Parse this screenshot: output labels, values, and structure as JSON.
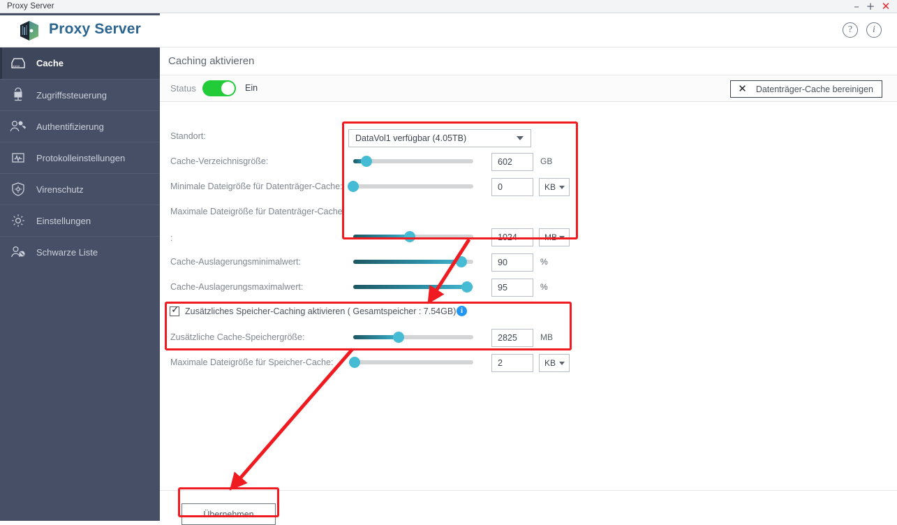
{
  "window": {
    "title": "Proxy Server",
    "minimize": "–",
    "maximize": "+",
    "close": "✕"
  },
  "header": {
    "app_title": "Proxy Server",
    "help_glyph": "?",
    "info_glyph": "i"
  },
  "sidebar": {
    "items": [
      {
        "label": "Cache",
        "icon": "drive-icon",
        "active": true
      },
      {
        "label": "Zugriffssteuerung",
        "icon": "lock-monitor-icon",
        "active": false
      },
      {
        "label": "Authentifizierung",
        "icon": "users-key-icon",
        "active": false
      },
      {
        "label": "Protokolleinstellungen",
        "icon": "chart-monitor-icon",
        "active": false
      },
      {
        "label": "Virenschutz",
        "icon": "shield-icon",
        "active": false
      },
      {
        "label": "Einstellungen",
        "icon": "gear-icon",
        "active": false
      },
      {
        "label": "Schwarze Liste",
        "icon": "user-block-icon",
        "active": false
      }
    ]
  },
  "main": {
    "section_title": "Caching aktivieren",
    "status": {
      "label": "Status",
      "value": "Ein",
      "toggle_on": true,
      "toggle_color": "#21cc38"
    },
    "clean_cache_button": {
      "label": "Datenträger-Cache bereinigen",
      "icon": "close-x-icon",
      "icon_glyph": "✕"
    },
    "location": {
      "label": "Standort:",
      "selected": "DataVol1 verfügbar (4.05TB)"
    },
    "rows": [
      {
        "id": "cache-dir-size",
        "label": "Cache-Verzeichnisgröße:",
        "value": "602",
        "unit": "GB",
        "unit_type": "plain",
        "slider_percent": 11
      },
      {
        "id": "min-file-size-disk",
        "label": "Minimale Dateigröße für Datenträger-Cache:",
        "value": "0",
        "unit": "KB",
        "unit_type": "select",
        "slider_percent": 0
      },
      {
        "id": "max-file-size-disk",
        "label": "Maximale Dateigröße für Datenträger-Cache",
        "label_continued": ":",
        "value": "1024",
        "unit": "MB",
        "unit_type": "select",
        "slider_percent": 47
      },
      {
        "id": "cache-min-threshold",
        "label": "Cache-Auslagerungsminimalwert:",
        "value": "90",
        "unit": "%",
        "unit_type": "plain",
        "slider_percent": 90
      },
      {
        "id": "cache-max-threshold",
        "label": "Cache-Auslagerungsmaximalwert:",
        "value": "95",
        "unit": "%",
        "unit_type": "plain",
        "slider_percent": 95
      }
    ],
    "memory_caching": {
      "checkbox_label": "Zusätzliches Speicher-Caching aktivieren ( Gesamtspeicher :  7.54GB)",
      "checked": true,
      "check_glyph": "✓",
      "info_glyph": "i",
      "info_color": "#2196f3",
      "size_row": {
        "id": "extra-cache-mem-size",
        "label": "Zusätzliche Cache-Speichergröße:",
        "value": "2825",
        "unit": "MB",
        "unit_type": "plain",
        "slider_percent": 38
      }
    },
    "max_file_size_mem": {
      "id": "max-file-size-mem",
      "label": "Maximale Dateigröße für Speicher-Cache:",
      "value": "2",
      "unit": "KB",
      "unit_type": "select",
      "slider_percent": 1
    },
    "apply_button": "Übernehmen"
  },
  "annotations": {
    "color": "#ef1b20",
    "boxes": [
      {
        "name": "location-sliders-highlight"
      },
      {
        "name": "memory-caching-highlight"
      },
      {
        "name": "apply-button-highlight"
      }
    ]
  }
}
